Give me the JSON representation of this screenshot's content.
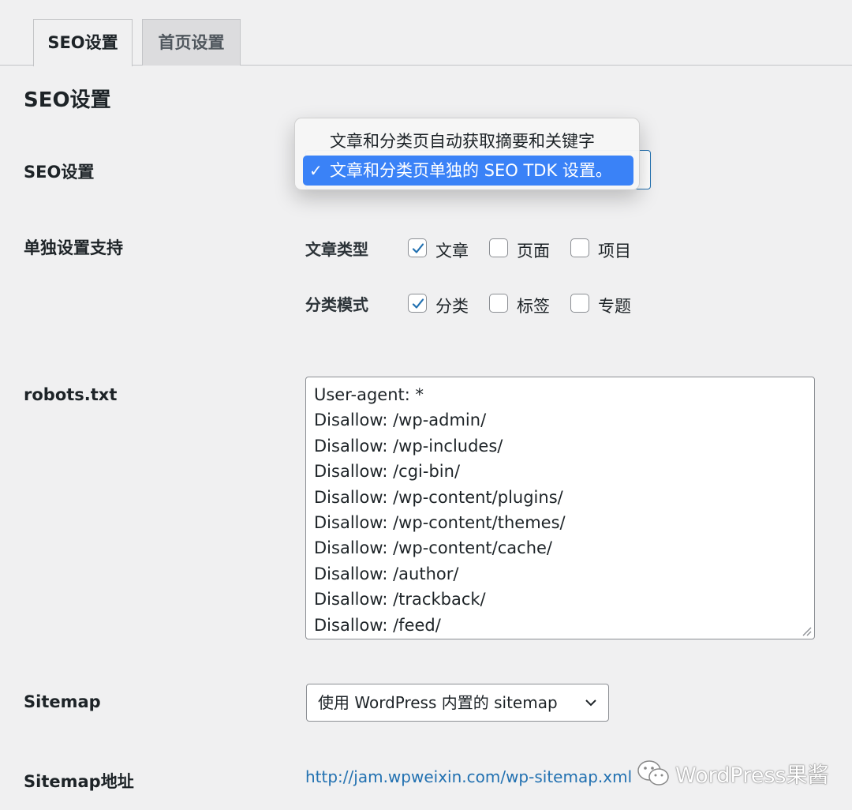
{
  "tabs": [
    {
      "label": "SEO设置",
      "active": true
    },
    {
      "label": "首页设置",
      "active": false
    }
  ],
  "section_title": "SEO设置",
  "seo_setting": {
    "label": "SEO设置",
    "options": [
      "文章和分类页自动获取摘要和关键字",
      "文章和分类页单独的 SEO TDK 设置。"
    ],
    "selected": "文章和分类页单独的 SEO TDK 设置。",
    "check_glyph": "✓"
  },
  "separate_support": {
    "label": "单独设置支持",
    "post_types": {
      "label": "文章类型",
      "items": [
        {
          "label": "文章",
          "checked": true
        },
        {
          "label": "页面",
          "checked": false
        },
        {
          "label": "项目",
          "checked": false
        }
      ]
    },
    "taxonomies": {
      "label": "分类模式",
      "items": [
        {
          "label": "分类",
          "checked": true
        },
        {
          "label": "标签",
          "checked": false
        },
        {
          "label": "专题",
          "checked": false
        }
      ]
    }
  },
  "robots": {
    "label": "robots.txt",
    "lines": [
      "User-agent: *",
      "Disallow: /wp-admin/",
      "Disallow: /wp-includes/",
      "Disallow: /cgi-bin/",
      "Disallow: /wp-content/plugins/",
      "Disallow: /wp-content/themes/",
      "Disallow: /wp-content/cache/",
      "Disallow: /author/",
      "Disallow: /trackback/",
      "Disallow: /feed/"
    ]
  },
  "sitemap": {
    "label": "Sitemap",
    "selected": "使用 WordPress 内置的 sitemap"
  },
  "sitemap_url": {
    "label": "Sitemap地址",
    "link": "http://jam.wpweixin.com/wp-sitemap.xml"
  },
  "watermark": {
    "text": "WordPress果酱",
    "icon": "wechat-icon"
  },
  "colors": {
    "accent": "#2271b1",
    "highlight": "#3a82f7",
    "check": "#2271b1"
  }
}
